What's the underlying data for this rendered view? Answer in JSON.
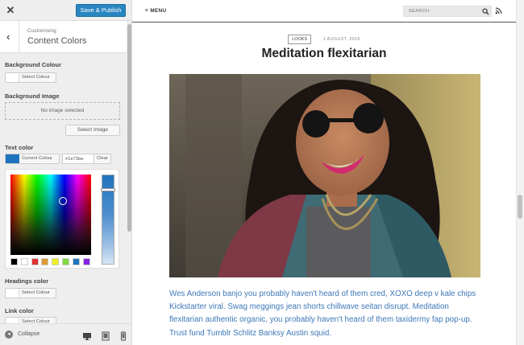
{
  "customizer": {
    "save_label": "Save & Publish",
    "breadcrumb": "Customising",
    "section_title": "Content Colors",
    "background_colour_label": "Background Colour",
    "select_colour_label": "Select Colour",
    "background_image_label": "Background Image",
    "no_image_text": "No image selected",
    "select_image_label": "Select Image",
    "text_color_label": "Text color",
    "current_colour_label": "Current Colour",
    "current_hex": "#1e73be",
    "clear_label": "Clear",
    "headings_color_label": "Headings color",
    "link_color_label": "Link color",
    "collapse_label": "Collapse",
    "palette": [
      "#000000",
      "#ffffff",
      "#dd3333",
      "#dd9933",
      "#eeee22",
      "#81d742",
      "#1e73be",
      "#8224e3"
    ],
    "accent": "#2a86c0"
  },
  "site": {
    "menu_label": "MENU",
    "search_placeholder": "SEARCH",
    "post": {
      "category": "LOOKS",
      "date": "1 AUGUST, 2016",
      "title": "Meditation flexitarian",
      "excerpt": "Wes Anderson banjo you probably haven't heard of them cred, XOXO deep v kale chips Kickstarter viral. Swag meggings jean shorts chillwave seitan disrupt. Meditation flexitarian authentic organic, you probably haven't heard of them taxidermy fap pop-up. Trust fund Tumblr Schlitz Banksy Austin squid."
    },
    "link_color": "#3e78b8"
  }
}
